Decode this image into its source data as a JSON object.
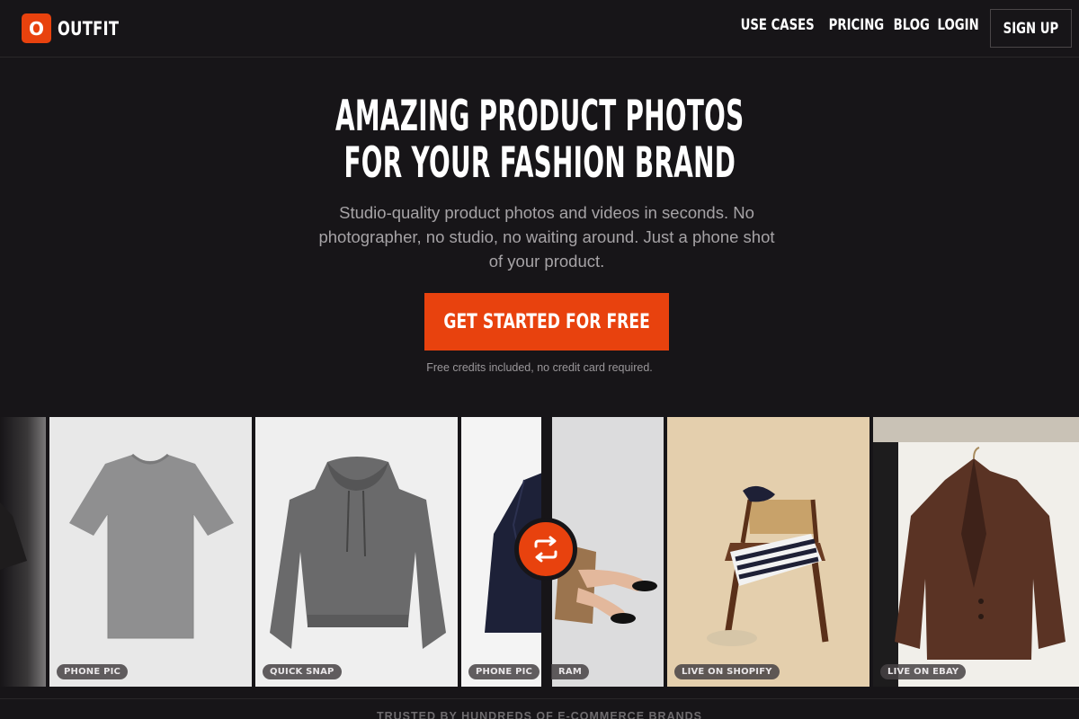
{
  "brand": {
    "logo_letter": "O",
    "name": "OUTFIT",
    "accent": "#e8420e"
  },
  "nav": {
    "links": [
      "USE CASES",
      "PRICING",
      "BLOG",
      "LOGIN"
    ],
    "signup": "SIGN UP"
  },
  "hero": {
    "title_line1": "AMAZING PRODUCT PHOTOS",
    "title_line2": "FOR YOUR FASHION BRAND",
    "subtitle": "Studio-quality product photos and videos in seconds. No photographer, no studio, no waiting around. Just a phone shot of your product.",
    "cta": "GET STARTED FOR FREE",
    "cta_note": "Free credits included, no credit card required."
  },
  "gallery": {
    "badges": [
      "PHONE PIC",
      "QUICK SNAP",
      "PHONE PIC",
      "RAM",
      "LIVE ON SHOPIFY",
      "LIVE ON EBAY"
    ],
    "swap_icon": "swap-arrows-icon"
  },
  "trusted": "TRUSTED BY HUNDREDS OF E-COMMERCE BRANDS"
}
